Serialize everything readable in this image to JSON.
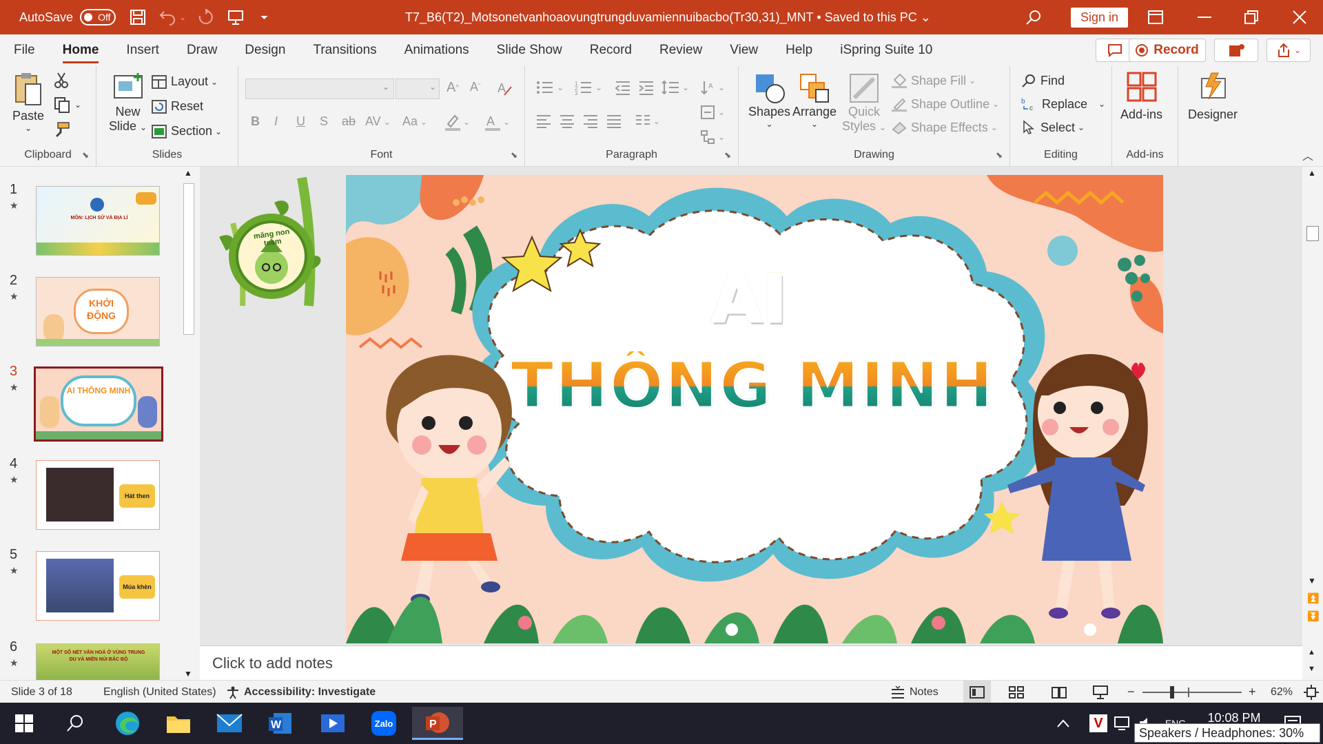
{
  "titlebar": {
    "autosave_label": "AutoSave",
    "autosave_state": "Off",
    "doc_title": "T7_B6(T2)_Motsonetvanhoaovungtrungduvamiennuibacbo(Tr30,31)_MNT • Saved to this PC ⌄",
    "sign_in": "Sign in"
  },
  "tabs": [
    "File",
    "Home",
    "Insert",
    "Draw",
    "Design",
    "Transitions",
    "Animations",
    "Slide Show",
    "Record",
    "Review",
    "View",
    "Help",
    "iSpring Suite 10"
  ],
  "record_button": "Record",
  "ribbon": {
    "clipboard": {
      "label": "Clipboard",
      "paste": "Paste"
    },
    "slides": {
      "label": "Slides",
      "new_slide_1": "New",
      "new_slide_2": "Slide",
      "layout": "Layout",
      "reset": "Reset",
      "section": "Section"
    },
    "font": {
      "label": "Font"
    },
    "paragraph": {
      "label": "Paragraph"
    },
    "drawing": {
      "label": "Drawing",
      "shapes": "Shapes",
      "arrange": "Arrange",
      "quick_styles_1": "Quick",
      "quick_styles_2": "Styles",
      "shape_fill": "Shape Fill",
      "shape_outline": "Shape Outline",
      "shape_effects": "Shape Effects"
    },
    "editing": {
      "label": "Editing",
      "find": "Find",
      "replace": "Replace",
      "select": "Select"
    },
    "addins": {
      "label": "Add-ins",
      "addins": "Add-ins"
    },
    "designer": {
      "label": "Designer"
    }
  },
  "thumbnails": [
    {
      "num": "1",
      "text": "MÔN: LỊCH SỬ VÀ ĐỊA LÍ"
    },
    {
      "num": "2",
      "text": "KHỞI ĐỘNG"
    },
    {
      "num": "3",
      "text": "AI THÔNG MINH"
    },
    {
      "num": "4",
      "text": "Hát then"
    },
    {
      "num": "5",
      "text": "Múa khèn"
    },
    {
      "num": "6",
      "text": "MỘT SỐ NÉT VĂN HOÁ Ở VÙNG TRUNG DU VÀ MIỀN NÚI BẮC BỘ"
    }
  ],
  "slide": {
    "line1": "AI",
    "line2": "THÔNG MINH",
    "logo_text": "măng non team"
  },
  "notes_placeholder": "Click to add notes",
  "status": {
    "slide_of": "Slide 3 of 18",
    "language": "English (United States)",
    "accessibility": "Accessibility: Investigate",
    "notes": "Notes",
    "zoom": "62%"
  },
  "taskbar": {
    "time": "10:08 PM",
    "lang": "ENG",
    "zalo": "Zalo",
    "tooltip": "Speakers / Headphones: 30%"
  },
  "colors": {
    "accent": "#c43e1c",
    "slide_bg": "#fbd7c5",
    "cloud_border": "#5bbcd0",
    "title_orange": "#f4911e",
    "title_teal": "#1f8f7e"
  }
}
